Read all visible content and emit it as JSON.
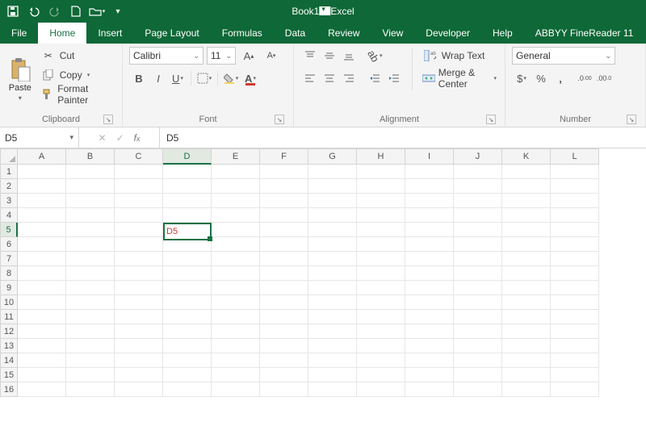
{
  "title": {
    "left": "Book1",
    "right": "Excel"
  },
  "tabs": [
    "File",
    "Home",
    "Insert",
    "Page Layout",
    "Formulas",
    "Data",
    "Review",
    "View",
    "Developer",
    "Help",
    "ABBYY FineReader 11"
  ],
  "active_tab": 1,
  "clipboard": {
    "paste": "Paste",
    "cut": "Cut",
    "copy": "Copy",
    "painter": "Format Painter",
    "label": "Clipboard"
  },
  "font": {
    "name": "Calibri",
    "size": "11",
    "label": "Font"
  },
  "alignment": {
    "wrap": "Wrap Text",
    "merge": "Merge & Center",
    "label": "Alignment"
  },
  "number": {
    "format": "General",
    "label": "Number"
  },
  "fbar": {
    "name": "D5",
    "formula": "D5"
  },
  "columns": [
    "A",
    "B",
    "C",
    "D",
    "E",
    "F",
    "G",
    "H",
    "I",
    "J",
    "K",
    "L"
  ],
  "rows": [
    1,
    2,
    3,
    4,
    5,
    6,
    7,
    8,
    9,
    10,
    11,
    12,
    13,
    14,
    15,
    16
  ],
  "active_col": 3,
  "active_row": 4,
  "cell_value": "D5"
}
